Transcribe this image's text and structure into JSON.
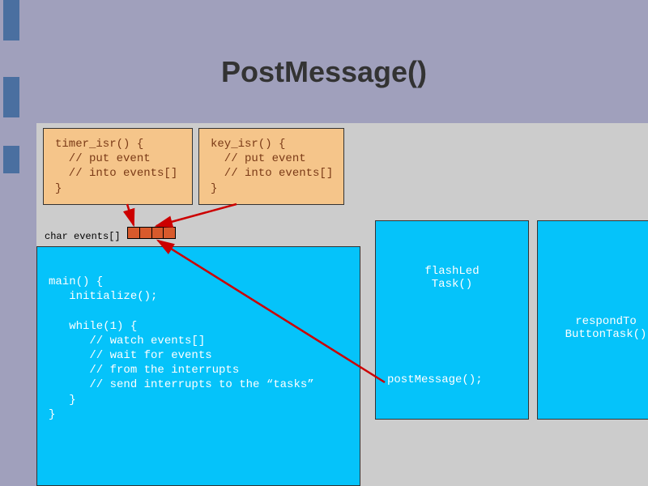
{
  "title": "PostMessage()",
  "timer_isr": "timer_isr() {\n  // put event\n  // into events[]\n}",
  "key_isr": "key_isr() {\n  // put event\n  // into events[]\n}",
  "events_label": "char events[]",
  "main": "main() {\n   initialize();\n\n   while(1) {\n      // watch events[]\n      // wait for events\n      // from the interrupts\n      // send interrupts to the “tasks”\n   }\n}",
  "flash": {
    "name": "flashLed\nTask()",
    "post": "postMessage();"
  },
  "respond": {
    "name": "respondTo\nButtonTask()"
  }
}
